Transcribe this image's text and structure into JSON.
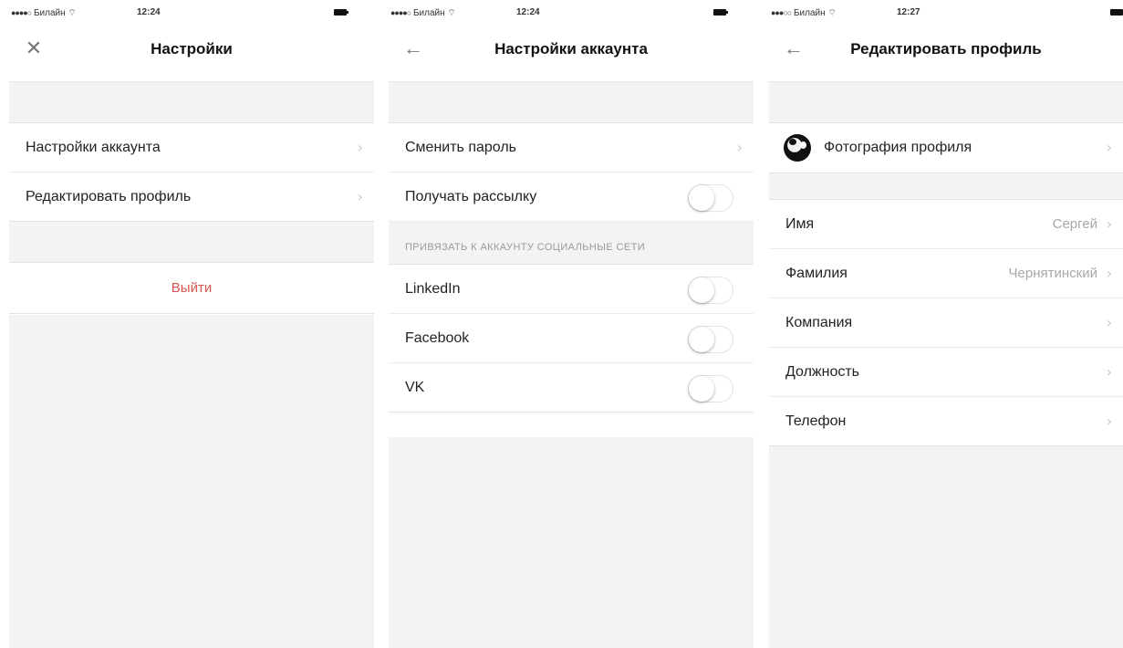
{
  "status": {
    "screen1": {
      "signal": "●●●●○",
      "carrier": "Билайн",
      "time": "12:24"
    },
    "screen2": {
      "signal": "●●●●○",
      "carrier": "Билайн",
      "time": "12:24"
    },
    "screen3": {
      "signal": "●●●○○",
      "carrier": "Билайн",
      "time": "12:27"
    }
  },
  "screen1": {
    "title": "Настройки",
    "nav_icon": "close-icon",
    "items": [
      {
        "label": "Настройки аккаунта"
      },
      {
        "label": "Редактировать профиль"
      }
    ],
    "logout_label": "Выйти",
    "logout_color": "#d9534f"
  },
  "screen2": {
    "title": "Настройки аккаунта",
    "nav_icon": "back-arrow-icon",
    "items": [
      {
        "label": "Сменить пароль"
      },
      {
        "label": "Получать рассылку",
        "toggle": "off"
      }
    ],
    "section_header": "ПРИВЯЗАТЬ К АККАУНТУ СОЦИАЛЬНЫЕ СЕТИ",
    "social": [
      {
        "label": "LinkedIn",
        "toggle": "off"
      },
      {
        "label": "Facebook",
        "toggle": "off"
      },
      {
        "label": "VK",
        "toggle": "off"
      }
    ]
  },
  "screen3": {
    "title": "Редактировать профиль",
    "nav_icon": "back-arrow-icon",
    "photo_label": "Фотография профиля",
    "fields": [
      {
        "label": "Имя",
        "value": "Сергей"
      },
      {
        "label": "Фамилия",
        "value": "Чернятинский"
      },
      {
        "label": "Компания",
        "value": ""
      },
      {
        "label": "Должность",
        "value": ""
      },
      {
        "label": "Телефон",
        "value": ""
      }
    ]
  }
}
